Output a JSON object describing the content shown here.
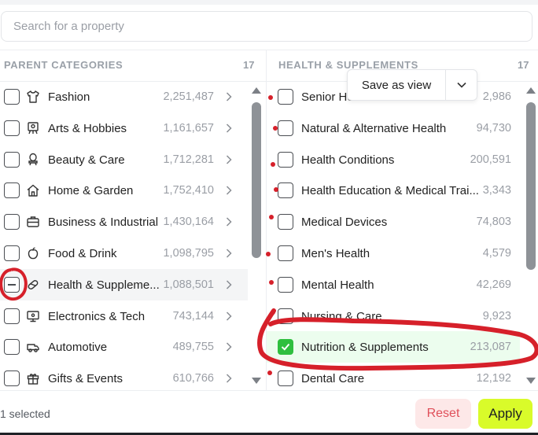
{
  "search": {
    "placeholder": "Search for a property"
  },
  "left_column": {
    "title": "PARENT CATEGORIES",
    "count": "17",
    "items": [
      {
        "label": "Fashion",
        "count": "2,251,487",
        "icon": "shirt-icon"
      },
      {
        "label": "Arts & Hobbies",
        "count": "1,161,657",
        "icon": "easel-icon"
      },
      {
        "label": "Beauty & Care",
        "count": "1,712,281",
        "icon": "mirror-icon"
      },
      {
        "label": "Home & Garden",
        "count": "1,752,410",
        "icon": "home-icon"
      },
      {
        "label": "Business & Industrial",
        "count": "1,430,164",
        "icon": "briefcase-icon"
      },
      {
        "label": "Food & Drink",
        "count": "1,098,795",
        "icon": "food-icon"
      },
      {
        "label": "Health & Suppleme...",
        "count": "1,088,501",
        "icon": "pill-icon",
        "state": "partial"
      },
      {
        "label": "Electronics & Tech",
        "count": "743,144",
        "icon": "monitor-icon"
      },
      {
        "label": "Automotive",
        "count": "489,755",
        "icon": "car-icon"
      },
      {
        "label": "Gifts & Events",
        "count": "610,766",
        "icon": "gift-icon"
      }
    ]
  },
  "right_column": {
    "title": "HEALTH & SUPPLEMENTS",
    "count": "17",
    "items": [
      {
        "label": "Senior He",
        "count": "2,986"
      },
      {
        "label": "Natural & Alternative Health",
        "count": "94,730"
      },
      {
        "label": "Health Conditions",
        "count": "200,591"
      },
      {
        "label": "Health Education & Medical Trai...",
        "count": "3,343"
      },
      {
        "label": "Medical Devices",
        "count": "74,803"
      },
      {
        "label": "Men's Health",
        "count": "4,579"
      },
      {
        "label": "Mental Health",
        "count": "42,269"
      },
      {
        "label": "Nursing & Care",
        "count": "9,923"
      },
      {
        "label": "Nutrition & Supplements",
        "count": "213,087",
        "state": "checked"
      },
      {
        "label": "Dental Care",
        "count": "12,192"
      }
    ]
  },
  "save_view": {
    "label": "Save as view"
  },
  "footer": {
    "selected_text": "1 selected",
    "reset_label": "Reset",
    "apply_label": "Apply"
  },
  "colors": {
    "accent_apply": "#d9fb2a",
    "reset_bg": "#fde8e8",
    "reset_text": "#e0505a",
    "checked_green": "#2fbf3f",
    "annotation_red": "#d6202a"
  }
}
